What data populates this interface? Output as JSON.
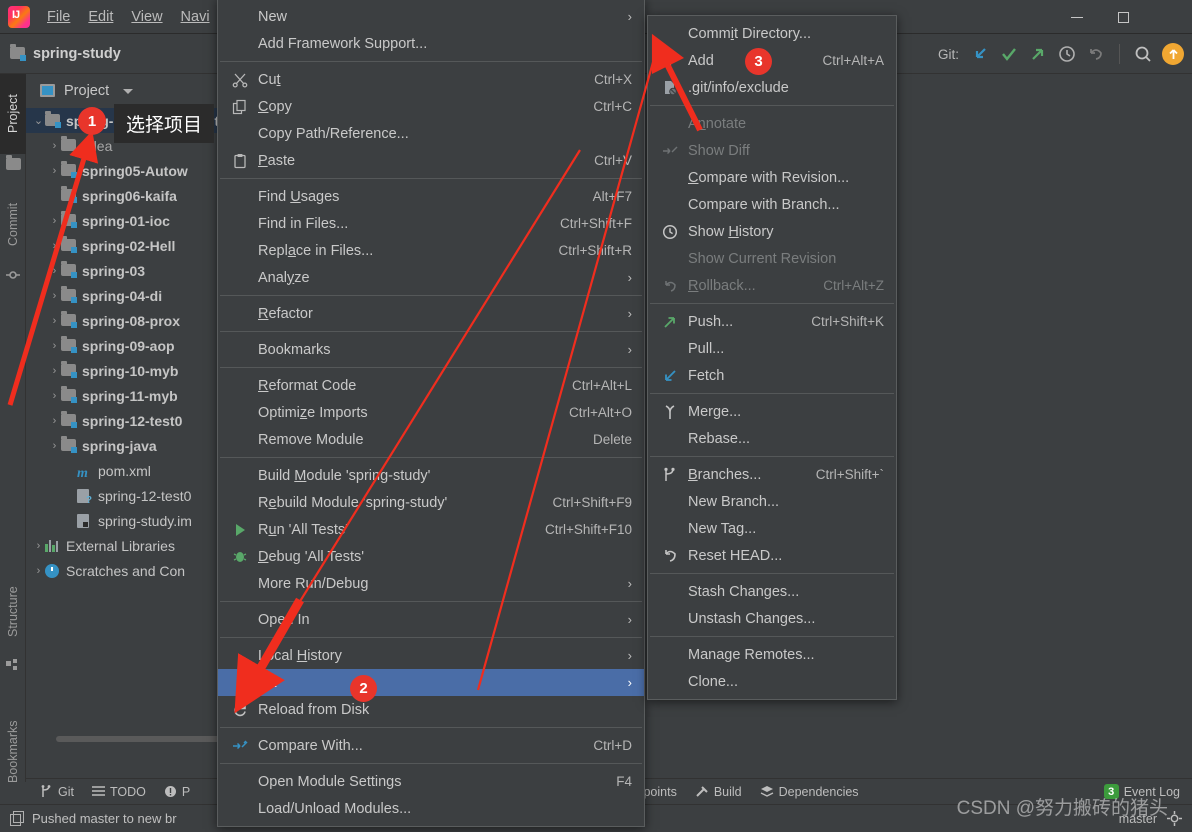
{
  "window": {
    "title": "spring-study",
    "minimize_label": "–",
    "maximize_label": "☐"
  },
  "menubar": {
    "items": [
      {
        "label": "File"
      },
      {
        "label": "Edit"
      },
      {
        "label": "View"
      },
      {
        "label": "Navi"
      }
    ]
  },
  "toolbar": {
    "git_label": "Git:",
    "icons": [
      "update-project-icon",
      "commit-icon",
      "push-icon",
      "history-icon",
      "rollback-icon",
      "search-icon",
      "updates-icon"
    ]
  },
  "toolstrip": {
    "left_items": [
      {
        "label": "Project",
        "icon": "project-folder-icon",
        "active": true
      },
      {
        "label": "Commit",
        "icon": "commit-icon",
        "active": false
      },
      {
        "label": "Structure",
        "icon": "structure-icon",
        "active": false
      },
      {
        "label": "Bookmarks",
        "icon": "bookmark-icon",
        "active": false
      }
    ]
  },
  "project_panel": {
    "header_label": "Project",
    "tree": [
      {
        "indent": 0,
        "arrow": "⌄",
        "icon": "module-folder-icon",
        "label": "spring-study [spring-stu",
        "bold": true,
        "selected": true
      },
      {
        "indent": 1,
        "arrow": "›",
        "icon": "folder-icon",
        "label": ".idea",
        "bold": false,
        "dim": true
      },
      {
        "indent": 1,
        "arrow": "›",
        "icon": "module-folder-icon",
        "label": "spring05-Autow",
        "bold": true
      },
      {
        "indent": 1,
        "arrow": "",
        "icon": "module-folder-icon",
        "label": "spring06-kaifa",
        "bold": true
      },
      {
        "indent": 1,
        "arrow": "›",
        "icon": "module-folder-icon",
        "label": "spring-01-ioc",
        "bold": true
      },
      {
        "indent": 1,
        "arrow": "›",
        "icon": "module-folder-icon",
        "label": "spring-02-Hell",
        "bold": true
      },
      {
        "indent": 1,
        "arrow": "›",
        "icon": "module-folder-icon",
        "label": "spring-03",
        "bold": true
      },
      {
        "indent": 1,
        "arrow": "›",
        "icon": "module-folder-icon",
        "label": "spring-04-di",
        "bold": true
      },
      {
        "indent": 1,
        "arrow": "›",
        "icon": "module-folder-icon",
        "label": "spring-08-prox",
        "bold": true
      },
      {
        "indent": 1,
        "arrow": "›",
        "icon": "module-folder-icon",
        "label": "spring-09-aop",
        "bold": true
      },
      {
        "indent": 1,
        "arrow": "›",
        "icon": "module-folder-icon",
        "label": "spring-10-myb",
        "bold": true
      },
      {
        "indent": 1,
        "arrow": "›",
        "icon": "module-folder-icon",
        "label": "spring-11-myb",
        "bold": true
      },
      {
        "indent": 1,
        "arrow": "›",
        "icon": "module-folder-icon",
        "label": "spring-12-test0",
        "bold": true
      },
      {
        "indent": 1,
        "arrow": "›",
        "icon": "module-folder-icon",
        "label": "spring-java",
        "bold": true
      },
      {
        "indent": 2,
        "arrow": "",
        "icon": "maven-pom-icon",
        "label": "pom.xml",
        "bold": false
      },
      {
        "indent": 2,
        "arrow": "",
        "icon": "iml-unknown-icon",
        "label": "spring-12-test0",
        "bold": false
      },
      {
        "indent": 2,
        "arrow": "",
        "icon": "iml-file-icon",
        "label": "spring-study.im",
        "bold": false
      },
      {
        "indent": 0,
        "arrow": "›",
        "icon": "external-libraries-icon",
        "label": "External Libraries",
        "bold": false
      },
      {
        "indent": 0,
        "arrow": "›",
        "icon": "scratches-icon",
        "label": "Scratches and Con",
        "bold": false
      }
    ]
  },
  "context_menu": {
    "items": [
      {
        "label": "New",
        "icon": "",
        "submenu": true
      },
      {
        "label": "Add Framework Support...",
        "icon": ""
      },
      {
        "separator": true
      },
      {
        "label": "Cut",
        "mnemonic": "t",
        "key": "Ctrl+X",
        "icon": "scissors-icon"
      },
      {
        "label": "Copy",
        "mnemonic": "C",
        "key": "Ctrl+C",
        "icon": "copy-icon"
      },
      {
        "label": "Copy Path/Reference...",
        "icon": ""
      },
      {
        "label": "Paste",
        "mnemonic": "P",
        "key": "Ctrl+V",
        "icon": "paste-icon"
      },
      {
        "separator": true
      },
      {
        "label": "Find Usages",
        "mnemonic": "U",
        "key": "Alt+F7",
        "icon": ""
      },
      {
        "label": "Find in Files...",
        "key": "Ctrl+Shift+F",
        "icon": ""
      },
      {
        "label": "Replace in Files...",
        "mnemonic": "a",
        "key": "Ctrl+Shift+R",
        "icon": ""
      },
      {
        "label": "Analyze",
        "mnemonic": "y",
        "submenu": true,
        "icon": ""
      },
      {
        "separator": true
      },
      {
        "label": "Refactor",
        "mnemonic": "R",
        "submenu": true,
        "icon": ""
      },
      {
        "separator": true
      },
      {
        "label": "Bookmarks",
        "submenu": true,
        "icon": ""
      },
      {
        "separator": true
      },
      {
        "label": "Reformat Code",
        "mnemonic": "R",
        "key": "Ctrl+Alt+L",
        "icon": ""
      },
      {
        "label": "Optimize Imports",
        "mnemonic": "z",
        "key": "Ctrl+Alt+O",
        "icon": ""
      },
      {
        "label": "Remove Module",
        "key": "Delete",
        "icon": ""
      },
      {
        "separator": true
      },
      {
        "label": "Build Module 'spring-study'",
        "mnemonic": "M",
        "icon": ""
      },
      {
        "label": "Rebuild Module 'spring-study'",
        "mnemonic": "e",
        "key": "Ctrl+Shift+F9",
        "icon": ""
      },
      {
        "label": "Run 'All Tests'",
        "mnemonic": "u",
        "key": "Ctrl+Shift+F10",
        "icon": "run-icon"
      },
      {
        "label": "Debug 'All Tests'",
        "mnemonic": "D",
        "icon": "debug-icon"
      },
      {
        "label": "More Run/Debug",
        "submenu": true,
        "icon": ""
      },
      {
        "separator": true
      },
      {
        "label": "Open In",
        "submenu": true,
        "icon": ""
      },
      {
        "separator": true
      },
      {
        "label": "Local History",
        "mnemonic": "H",
        "submenu": true,
        "icon": ""
      },
      {
        "label": "Git",
        "mnemonic": "G",
        "submenu": true,
        "icon": "",
        "highlighted": true
      },
      {
        "label": "Reload from Disk",
        "icon": "reload-icon"
      },
      {
        "separator": true
      },
      {
        "label": "Compare With...",
        "key": "Ctrl+D",
        "icon": "compare-icon"
      },
      {
        "separator": true
      },
      {
        "label": "Open Module Settings",
        "key": "F4",
        "icon": ""
      },
      {
        "label": "Load/Unload Modules...",
        "icon": ""
      }
    ]
  },
  "git_submenu": {
    "items": [
      {
        "label": "Commit Directory...",
        "mnemonic": "i",
        "icon": ""
      },
      {
        "label": "Add",
        "key": "Ctrl+Alt+A",
        "icon": "plus-icon"
      },
      {
        "label": ".git/info/exclude",
        "icon": "exclude-file-icon"
      },
      {
        "separator": true
      },
      {
        "label": "Annotate",
        "mnemonic": "n",
        "disabled": true,
        "icon": ""
      },
      {
        "label": "Show Diff",
        "disabled": true,
        "icon": "diff-icon"
      },
      {
        "label": "Compare with Revision...",
        "mnemonic": "C",
        "icon": ""
      },
      {
        "label": "Compare with Branch...",
        "icon": ""
      },
      {
        "label": "Show History",
        "mnemonic": "H",
        "icon": "clock-icon"
      },
      {
        "label": "Show Current Revision",
        "disabled": true,
        "icon": ""
      },
      {
        "label": "Rollback...",
        "mnemonic": "R",
        "key": "Ctrl+Alt+Z",
        "disabled": true,
        "icon": "rollback-icon"
      },
      {
        "separator": true
      },
      {
        "label": "Push...",
        "key": "Ctrl+Shift+K",
        "icon": "push-icon"
      },
      {
        "label": "Pull...",
        "icon": ""
      },
      {
        "label": "Fetch",
        "icon": "fetch-icon"
      },
      {
        "separator": true
      },
      {
        "label": "Merge...",
        "icon": "merge-icon"
      },
      {
        "label": "Rebase...",
        "icon": ""
      },
      {
        "separator": true
      },
      {
        "label": "Branches...",
        "mnemonic": "B",
        "key": "Ctrl+Shift+`",
        "icon": "branch-icon"
      },
      {
        "label": "New Branch...",
        "icon": ""
      },
      {
        "label": "New Tag...",
        "icon": ""
      },
      {
        "label": "Reset HEAD...",
        "icon": "reset-icon"
      },
      {
        "separator": true
      },
      {
        "label": "Stash Changes...",
        "icon": ""
      },
      {
        "label": "Unstash Changes...",
        "icon": ""
      },
      {
        "separator": true
      },
      {
        "label": "Manage Remotes...",
        "icon": ""
      },
      {
        "label": "Clone...",
        "icon": ""
      }
    ]
  },
  "toolwindow_bar": {
    "left_items": [
      {
        "label": "Git",
        "icon": "branch-icon"
      },
      {
        "label": "TODO",
        "icon": "list-icon"
      },
      {
        "label": "P",
        "icon": "problems-icon"
      }
    ],
    "right_items": [
      {
        "label": "Endpoints",
        "icon": "endpoints-icon"
      },
      {
        "label": "Build",
        "icon": "hammer-icon"
      },
      {
        "label": "Dependencies",
        "icon": "layers-icon"
      }
    ],
    "event_log_label": "Event Log",
    "event_log_count": "3"
  },
  "statusbar": {
    "message": "Pushed master to new br",
    "branch": "master"
  },
  "annotations": {
    "tooltip_text": "选择项目",
    "badges": [
      {
        "num": "1"
      },
      {
        "num": "2"
      },
      {
        "num": "3"
      }
    ],
    "accent_color": "#e8352b",
    "highlight_color": "#4a6da7"
  },
  "watermark": {
    "text": "CSDN @努力搬砖的猪头"
  }
}
